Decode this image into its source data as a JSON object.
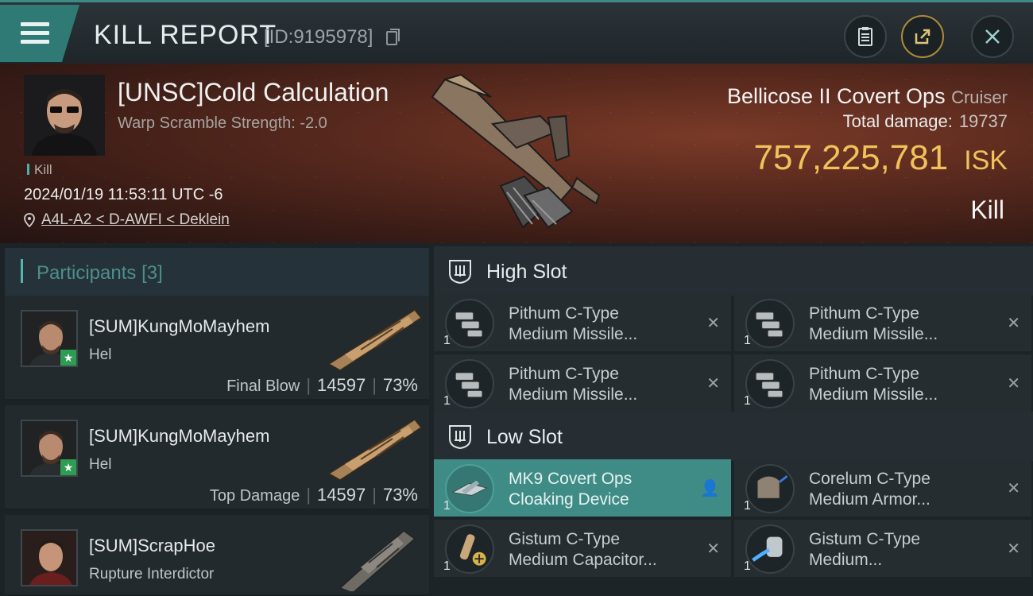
{
  "header": {
    "title": "KILL REPORT",
    "report_id": "[ID:9195978]",
    "icons": [
      "menu-icon",
      "copy-icon",
      "clipboard-icon",
      "share-icon",
      "close-icon"
    ]
  },
  "victim": {
    "name": "[UNSC]Cold Calculation",
    "warp_scramble": "Warp Scramble Strength: -2.0",
    "tag": "Kill",
    "datetime": "2024/01/19 11:53:11 UTC -6",
    "location": "A4L-A2 < D-AWFI < Deklein"
  },
  "ship": {
    "name": "Bellicose II Covert Ops",
    "class": "Cruiser",
    "damage_label": "Total damage:",
    "damage_value": "19737",
    "isk_value": "757,225,781",
    "isk_unit": "ISK",
    "result": "Kill"
  },
  "participants": {
    "title": "Participants",
    "count": "[3]",
    "items": [
      {
        "name": "[SUM]KungMoMayhem",
        "ship": "Hel",
        "label": "Final Blow",
        "damage": "14597",
        "percent": "73%"
      },
      {
        "name": "[SUM]KungMoMayhem",
        "ship": "Hel",
        "label": "Top Damage",
        "damage": "14597",
        "percent": "73%"
      },
      {
        "name": "[SUM]ScrapHoe",
        "ship": "Rupture Interdictor"
      }
    ]
  },
  "fittings": {
    "high_slot": {
      "title": "High Slot",
      "modules": [
        {
          "line1": "Pithum C-Type",
          "line2": "Medium Missile...",
          "qty": "1",
          "action": "✕"
        },
        {
          "line1": "Pithum C-Type",
          "line2": "Medium Missile...",
          "qty": "1",
          "action": "✕"
        },
        {
          "line1": "Pithum C-Type",
          "line2": "Medium Missile...",
          "qty": "1",
          "action": "✕"
        },
        {
          "line1": "Pithum C-Type",
          "line2": "Medium Missile...",
          "qty": "1",
          "action": "✕"
        }
      ]
    },
    "low_slot": {
      "title": "Low Slot",
      "modules": [
        {
          "line1": "MK9 Covert Ops",
          "line2": "Cloaking Device",
          "qty": "1",
          "action": "👤"
        },
        {
          "line1": "Corelum C-Type",
          "line2": "Medium Armor...",
          "qty": "1",
          "action": "✕"
        },
        {
          "line1": "Gistum C-Type",
          "line2": "Medium Capacitor...",
          "qty": "1",
          "action": "✕"
        },
        {
          "line1": "Gistum C-Type",
          "line2": "Medium...",
          "qty": "1",
          "action": "✕"
        }
      ]
    }
  },
  "colors": {
    "accent_teal": "#3f8c86",
    "isk_gold": "#f1c25b",
    "hero_red": "#5a2a1e"
  }
}
